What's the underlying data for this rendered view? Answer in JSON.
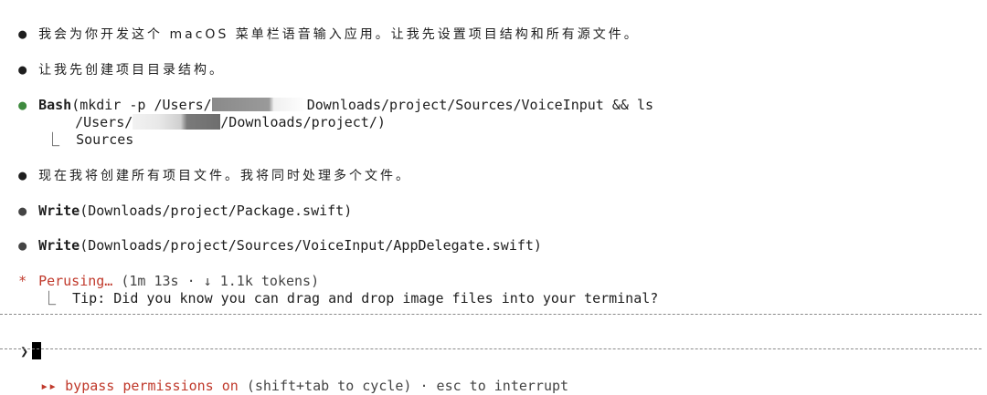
{
  "messages": {
    "m1": "我会为你开发这个 macOS 菜单栏语音输入应用。让我先设置项目结构和所有源文件。",
    "m2": "让我先创建项目目录结构。",
    "bash": {
      "tool": "Bash",
      "cmd_start": "(mkdir -p /Users/",
      "cmd_mid": "Downloads/project/Sources/VoiceInput && ls",
      "cont_start": "/Users/",
      "cont_end": "/Downloads/project/)",
      "output": "Sources"
    },
    "m3": "现在我将创建所有项目文件。我将同时处理多个文件。",
    "write1": {
      "tool": "Write",
      "args": "(Downloads/project/Package.swift)"
    },
    "write2": {
      "tool": "Write",
      "args": "(Downloads/project/Sources/VoiceInput/AppDelegate.swift)"
    },
    "status": {
      "spinner": "*",
      "label": "Perusing…",
      "detail": "(1m 13s · ↓ 1.1k tokens)",
      "tip": "Tip: Did you know you can drag and drop image files into your terminal?"
    }
  },
  "prompt": {
    "symbol": "❯"
  },
  "footer": {
    "arrows": "▸▸",
    "mode": "bypass permissions on",
    "hint": "(shift+tab to cycle) · esc to interrupt"
  },
  "colors": {
    "green": "#3e8a3e",
    "red": "#c0392b",
    "divider": "#8a8a8a"
  }
}
